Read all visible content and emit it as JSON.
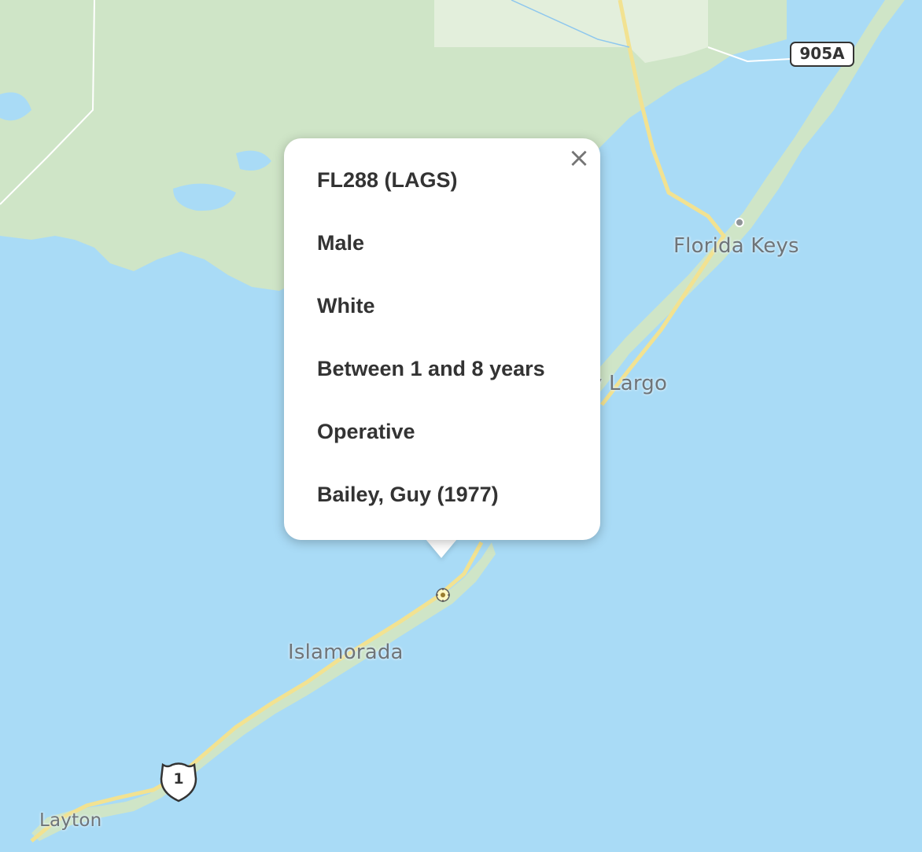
{
  "map": {
    "labels": {
      "florida_keys": "Florida Keys",
      "key_largo": "y Largo",
      "islamorada": "Islamorada",
      "layton": "Layton"
    },
    "shields": {
      "state_route": "905A",
      "us_route": "1"
    },
    "colors": {
      "water": "#a9dbf6",
      "land": "#cfe5c7",
      "highway": "#f2e291"
    }
  },
  "popup": {
    "close_symbol": "×",
    "lines": [
      "FL288 (LAGS)",
      "Male",
      "White",
      "Between 1 and 8 years",
      "Operative",
      "Bailey, Guy (1977)"
    ]
  }
}
